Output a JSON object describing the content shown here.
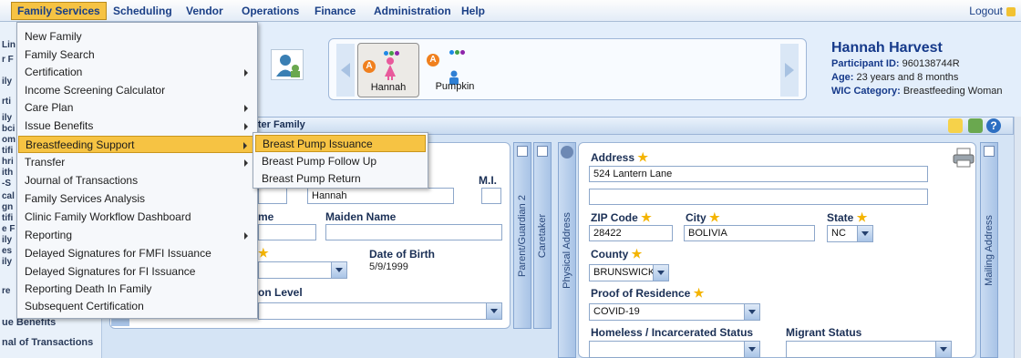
{
  "menubar": {
    "items": [
      "Family Services",
      "Scheduling",
      "Vendor",
      "Operations",
      "Finance",
      "Administration",
      "Help"
    ],
    "logout": "Logout"
  },
  "family_services_menu": [
    {
      "label": "New Family",
      "submenu": false
    },
    {
      "label": "Family Search",
      "submenu": false
    },
    {
      "label": "Certification",
      "submenu": true
    },
    {
      "label": "Income Screening Calculator",
      "submenu": false
    },
    {
      "label": "Care Plan",
      "submenu": true
    },
    {
      "label": "Issue Benefits",
      "submenu": true
    },
    {
      "label": "Breastfeeding Support",
      "submenu": true
    },
    {
      "label": "Transfer",
      "submenu": true
    },
    {
      "label": "Journal of Transactions",
      "submenu": false
    },
    {
      "label": "Family Services Analysis",
      "submenu": false
    },
    {
      "label": "Clinic Family Workflow Dashboard",
      "submenu": false
    },
    {
      "label": "Reporting",
      "submenu": true
    },
    {
      "label": "Delayed Signatures for FMFI Issuance",
      "submenu": false
    },
    {
      "label": "Delayed Signatures for FI Issuance",
      "submenu": false
    },
    {
      "label": "Reporting Death In Family",
      "submenu": false
    },
    {
      "label": "Subsequent Certification",
      "submenu": false
    }
  ],
  "breastfeeding_submenu": [
    "Breast Pump Issuance",
    "Breast Pump Follow Up",
    "Breast Pump Return"
  ],
  "left_nav": {
    "fragments": [
      "Lin",
      "r F",
      "ily",
      "rti",
      "ily",
      "bci",
      "om",
      "tifi",
      "hri",
      "ith",
      "-S",
      "cal",
      "gn",
      "tifi",
      "e F",
      "ily",
      "es",
      "ily",
      "re"
    ],
    "items": [
      "ue Benefits",
      "nal of Transactions"
    ]
  },
  "family_members": [
    {
      "name": "Hannah",
      "badge": "A",
      "selected": true
    },
    {
      "name": "Pumpkin",
      "badge": "A",
      "selected": false
    }
  ],
  "participant": {
    "name": "Hannah Harvest",
    "id_label": "Participant ID:",
    "id": "960138744R",
    "age_label": "Age:",
    "age": "23 years and 8 months",
    "category_label": "WIC Category:",
    "category": "Breastfeeding Woman"
  },
  "title_bar": {
    "text": "oster Family"
  },
  "vertical_tabs": [
    "Parent/Guardian 2",
    "Caretaker",
    "Physical Address",
    "Mailing Address"
  ],
  "guardian": {
    "mi_label": "M.I.",
    "first_name": "Hannah",
    "name_label_fragment": "me",
    "maiden_name_label": "Maiden Name",
    "dob_label": "Date of Birth",
    "dob": "5/9/1999",
    "education_label_fragment": "on Level"
  },
  "address": {
    "address_label": "Address",
    "address_line1": "524 Lantern Lane",
    "address_line2": "",
    "zip_label": "ZIP Code",
    "zip": "28422",
    "city_label": "City",
    "city": "BOLIVIA",
    "state_label": "State",
    "state": "NC",
    "county_label": "County",
    "county": "BRUNSWICK",
    "proof_label": "Proof of Residence",
    "proof": "COVID-19",
    "homeless_label": "Homeless / Incarcerated Status",
    "homeless": "",
    "migrant_label": "Migrant Status",
    "migrant": ""
  },
  "colors": {
    "accent": "#f6c343",
    "brand": "#1a3f86"
  }
}
